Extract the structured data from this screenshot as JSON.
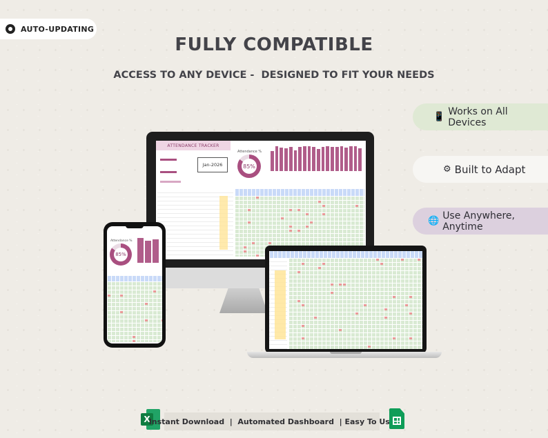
{
  "badge": {
    "label": "AUTO-UPDATING",
    "icon": "gear-icon"
  },
  "header": {
    "title": "FULLY COMPATIBLE",
    "subtitle": "ACCESS TO ANY DEVICE -  DESIGNED TO FIT YOUR NEEDS"
  },
  "features": [
    {
      "icon": "mobile-phone-icon",
      "glyph": "📱",
      "label": "Works on All Devices",
      "color": "#dfe9d4"
    },
    {
      "icon": "gear-icon",
      "glyph": "⚙",
      "label": "Built to Adapt",
      "color": "#f7f6f3"
    },
    {
      "icon": "globe-icon",
      "glyph": "🌐",
      "label": "Use Anywhere, Anytime",
      "color": "#dcd0de"
    }
  ],
  "tracker": {
    "title": "ATTENDANCE TRACKER",
    "month": "Jan-2026",
    "attendance_label": "Attendance %",
    "attendance_pct": "85%",
    "attendance_value": 0.85,
    "accent": "#a94f80"
  },
  "footer": {
    "text": "Instant Download  |  Automated Dashboard  | Easy To Use",
    "excel_icon": "excel-icon",
    "sheets_icon": "google-sheets-icon"
  }
}
